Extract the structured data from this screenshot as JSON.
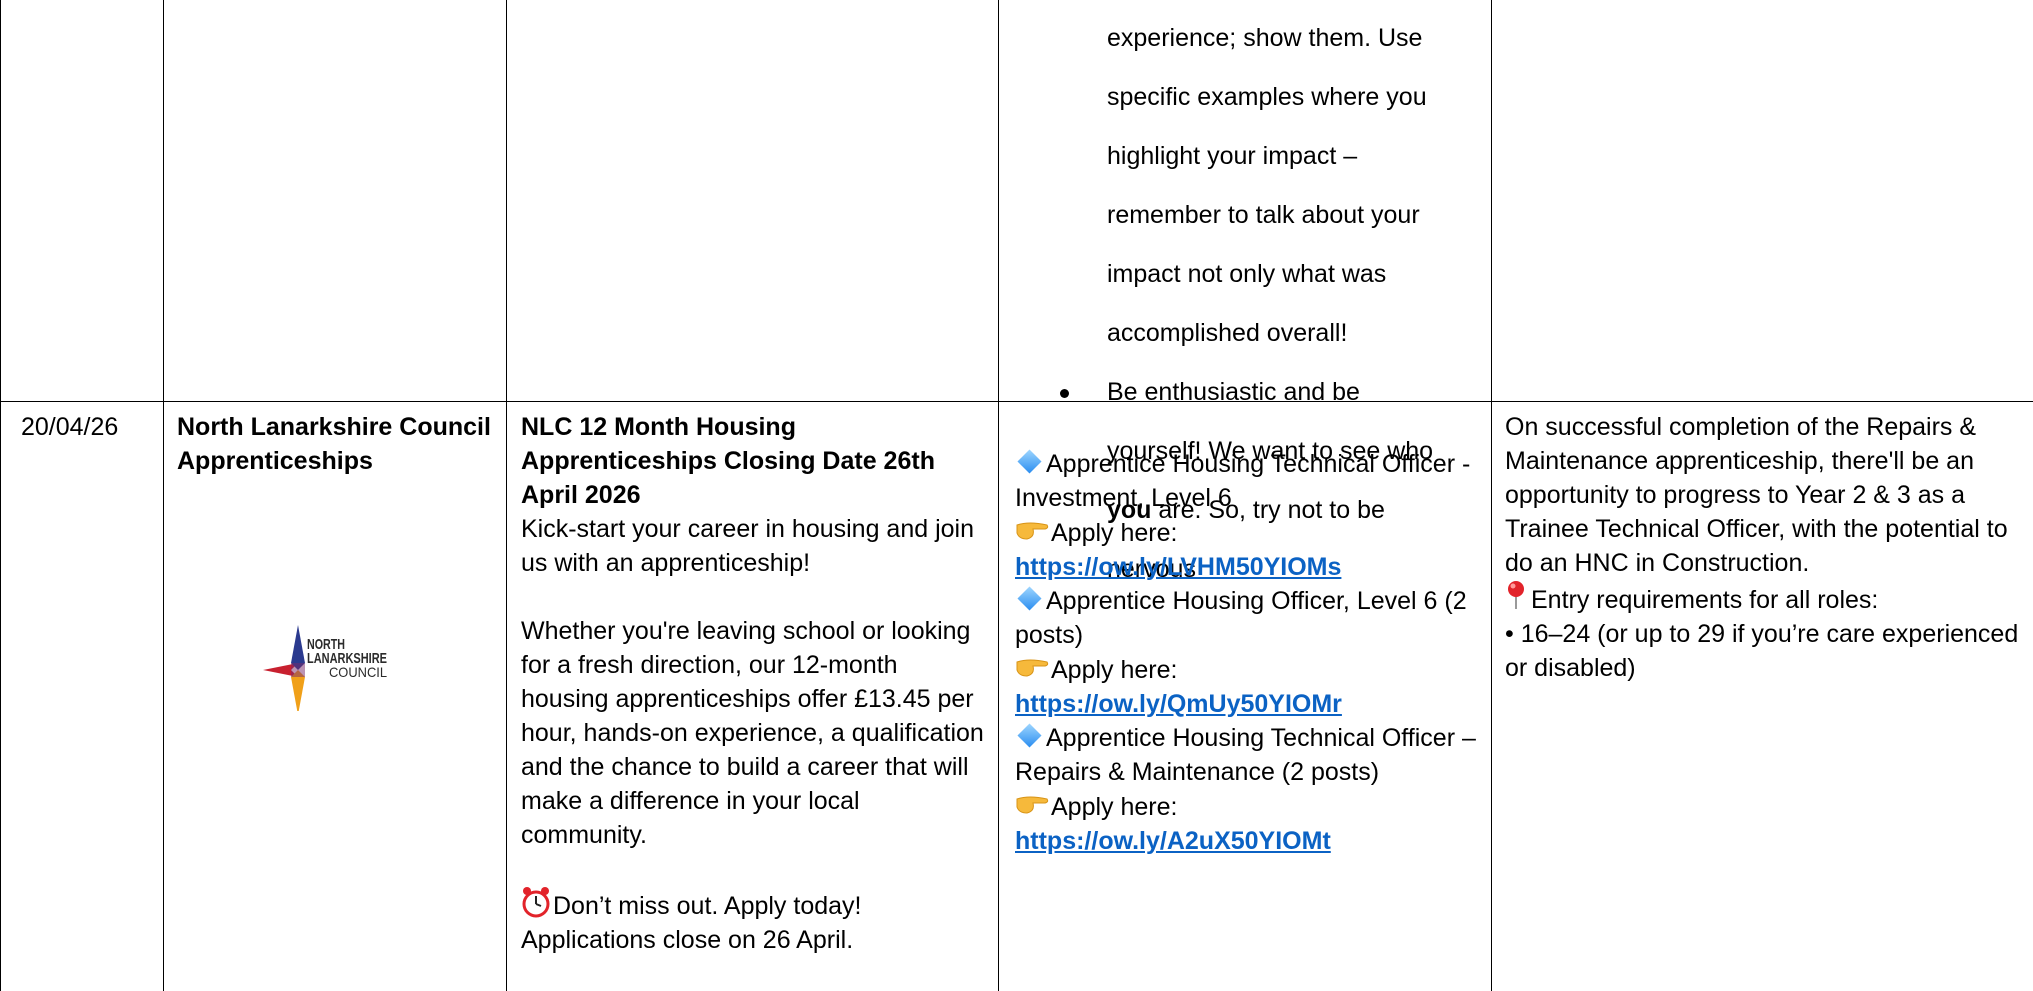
{
  "prev_row": {
    "tips": [
      "experience; show them. Use specific examples where you highlight your impact – remember to talk about your impact not only what was accomplished overall!",
      {
        "before": "Be enthusiastic and be yourself! We want to see who ",
        "bold": "you",
        "after": " are. So, try not to be nervous"
      }
    ],
    "tip1_lines": [
      "experience; show them. Use",
      "specific examples where you",
      "highlight your impact –",
      "remember to talk about your",
      "impact not only what was",
      "accomplished overall!"
    ],
    "tip2_line1": "Be enthusiastic and be",
    "tip2_line2": "yourself! We want to see who",
    "tip2_bold": "you",
    "tip2_line3_rest": " are. So, try not to be",
    "tip2_line4": "nervous"
  },
  "row": {
    "date": "20/04/26",
    "employer": "North Lanarkshire Council Apprenticeships",
    "logo_text": [
      "NORTH",
      "LANARKSHIRE",
      "COUNCIL"
    ],
    "title": "NLC 12 Month Housing Apprenticeships Closing Date 26th April 2026",
    "intro": "Kick-start your career in housing and join us with an apprenticeship!",
    "body": "Whether you're leaving school or looking for a fresh direction, our 12-month housing apprenticeships offer £13.45 per hour, hands-on experience, a qualification and the chance to build a career that will make a difference in your local community.",
    "deadline_line1": "Don’t miss out. Apply today!",
    "deadline_line2": "Applications close on 26 April.",
    "roles": [
      {
        "title": "Apprentice Housing Technical Officer - Investment, Level 6",
        "apply_label": "Apply here:",
        "url": "https://ow.ly/LVHM50YIOMs"
      },
      {
        "title": "Apprentice Housing Officer, Level 6 (2 posts)",
        "apply_label": "Apply here:",
        "url": "https://ow.ly/QmUy50YIOMr"
      },
      {
        "title": "Apprentice Housing Technical Officer – Repairs & Maintenance (2 posts)",
        "apply_label": "Apply here:",
        "url": "https://ow.ly/A2uX50YIOMt"
      }
    ],
    "notes": "On successful completion of the Repairs & Maintenance apprenticeship, there'll be an opportunity to progress to Year 2 & 3 as a Trainee Technical Officer, with the potential to do an HNC in Construction.",
    "entry_heading": "Entry requirements for all roles:",
    "entry_item": "• 16–24 (or up to 29 if you’re care experienced or disabled)"
  },
  "icons": {
    "bullet": "bullet-dot-icon",
    "diamond": "blue-diamond-icon",
    "hand": "pointing-hand-icon",
    "pin": "round-pushpin-icon",
    "clock": "alarm-clock-icon"
  },
  "colors": {
    "link": "#0b62c4",
    "logo_red": "#c8202f",
    "logo_blue": "#2b3a8f",
    "logo_orange": "#f0a019"
  }
}
